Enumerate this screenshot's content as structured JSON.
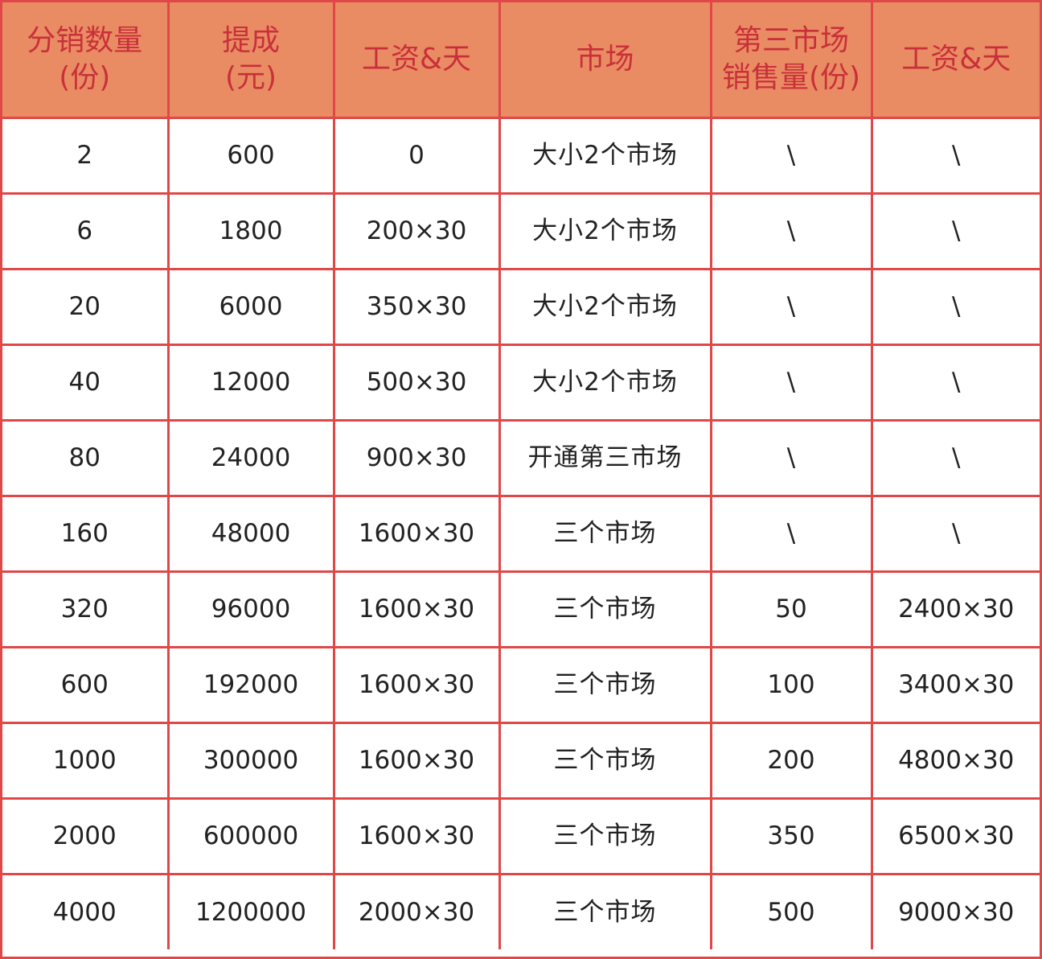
{
  "table": {
    "headers": [
      "分销数量\n(份)",
      "提成\n(元)",
      "工资&天",
      "市场",
      "第三市场\n销售量(份)",
      "工资&天"
    ],
    "rows": [
      [
        "2",
        "600",
        "0",
        "大小2个市场",
        "\\",
        "\\"
      ],
      [
        "6",
        "1800",
        "200×30",
        "大小2个市场",
        "\\",
        "\\"
      ],
      [
        "20",
        "6000",
        "350×30",
        "大小2个市场",
        "\\",
        "\\"
      ],
      [
        "40",
        "12000",
        "500×30",
        "大小2个市场",
        "\\",
        "\\"
      ],
      [
        "80",
        "24000",
        "900×30",
        "开通第三市场",
        "\\",
        "\\"
      ],
      [
        "160",
        "48000",
        "1600×30",
        "三个市场",
        "\\",
        "\\"
      ],
      [
        "320",
        "96000",
        "1600×30",
        "三个市场",
        "50",
        "2400×30"
      ],
      [
        "600",
        "192000",
        "1600×30",
        "三个市场",
        "100",
        "3400×30"
      ],
      [
        "1000",
        "300000",
        "1600×30",
        "三个市场",
        "200",
        "4800×30"
      ],
      [
        "2000",
        "600000",
        "1600×30",
        "三个市场",
        "350",
        "6500×30"
      ],
      [
        "4000",
        "1200000",
        "2000×30",
        "三个市场",
        "500",
        "9000×30"
      ]
    ]
  },
  "colors": {
    "header_bg": "#ea8c63",
    "header_text": "#c8303a",
    "grid_line": "#e04848",
    "cell_text": "#222222"
  }
}
